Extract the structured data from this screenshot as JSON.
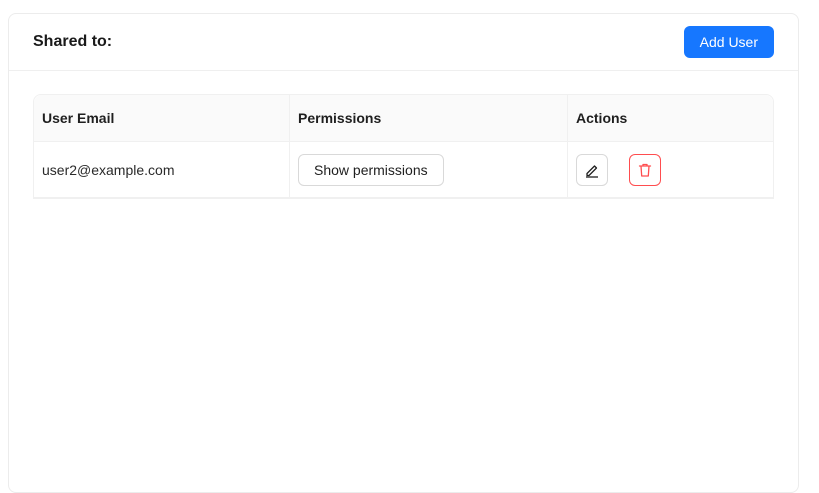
{
  "header": {
    "title": "Shared to:",
    "add_user_label": "Add User"
  },
  "table": {
    "columns": [
      "User Email",
      "Permissions",
      "Actions"
    ],
    "rows": [
      {
        "email": "user2@example.com",
        "permissions_button": "Show permissions",
        "actions": [
          "edit-icon",
          "trash-icon"
        ]
      }
    ]
  },
  "colors": {
    "primary": "#1677ff",
    "danger": "#ff4d4f"
  }
}
